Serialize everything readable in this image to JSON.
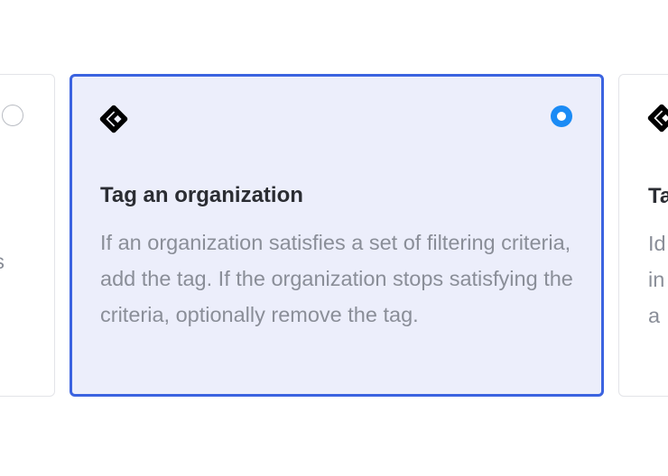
{
  "cards": [
    {
      "selected": false,
      "icon": "tag-icon",
      "title": "",
      "description_fragment": "s"
    },
    {
      "selected": true,
      "icon": "tag-icon",
      "title": "Tag an organization",
      "description": "If an organization satisfies a set of filtering criteria, add the tag. If the organization stops satisfying the criteria, optionally remove the tag."
    },
    {
      "selected": false,
      "icon": "tag-icon",
      "title_fragment": "Ta",
      "description_lines": [
        "Id",
        "in",
        "a"
      ]
    }
  ],
  "colors": {
    "selected_border": "#3b63e0",
    "selected_background": "#eceefb",
    "radio_active": "#1b8bf5",
    "title_text": "#2b2d33",
    "description_text": "#8a8e98"
  }
}
